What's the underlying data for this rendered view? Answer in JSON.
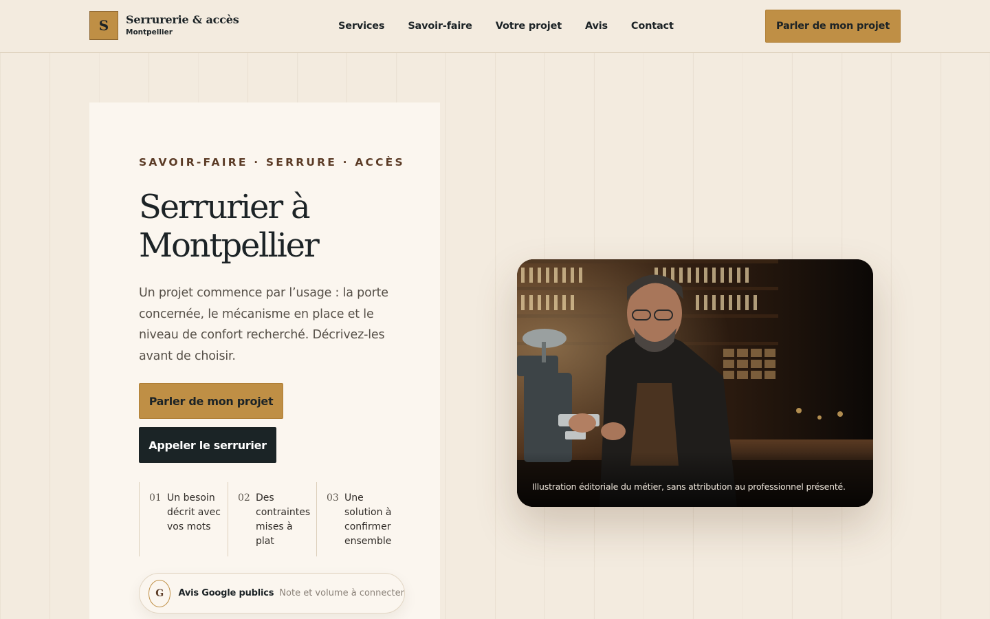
{
  "brand": {
    "mark": "S",
    "name": "Serrurerie & accès",
    "city": "Montpellier"
  },
  "nav": {
    "items": [
      "Services",
      "Savoir-faire",
      "Votre projet",
      "Avis",
      "Contact"
    ]
  },
  "header": {
    "cta_label": "Parler de mon projet"
  },
  "hero": {
    "eyebrow": "SAVOIR-FAIRE · SERRURE · ACCÈS",
    "title": "Serrurier à Montpellier",
    "lead": "Un projet commence par l’usage : la porte concernée, le mécanisme en place et le niveau de confort recherché. Décrivez-les avant de choisir.",
    "primary_cta": "Parler de mon projet",
    "secondary_cta": "Appeler le serrurier",
    "steps": [
      {
        "num": "01",
        "text": "Un besoin décrit avec vos mots"
      },
      {
        "num": "02",
        "text": "Des contraintes mises à plat"
      },
      {
        "num": "03",
        "text": "Une solution à confirmer ensemble"
      }
    ],
    "review": {
      "icon_letter": "G",
      "icon": "google-icon",
      "title": "Avis Google publics",
      "note": "Note et volume à connecter"
    }
  },
  "photo": {
    "caption": "Illustration éditoriale du métier, sans attribution au professionnel présenté."
  },
  "colors": {
    "background": "#f3ebdf",
    "card": "#fbf6ef",
    "accent_gold": "#bf8f45",
    "dark": "#1b2426",
    "eyebrow_brown": "#5b3b26"
  }
}
